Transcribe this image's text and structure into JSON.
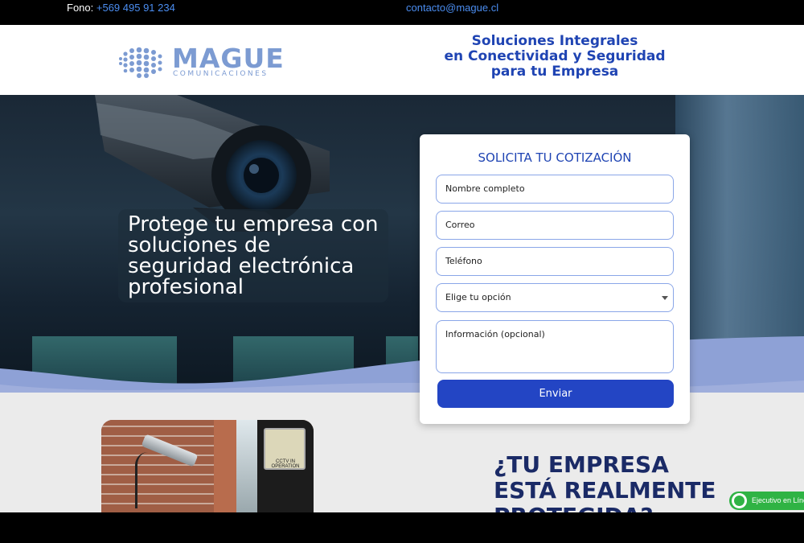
{
  "topbar": {
    "phone_label": "Fono:",
    "phone_number": "+569 495 91 234",
    "email": "contacto@mague.cl"
  },
  "header": {
    "logo_word": "MAGUE",
    "logo_sub": "COMUNICACIONES",
    "tagline_line1": "Soluciones Integrales",
    "tagline_line2": "en Conectividad y Seguridad",
    "tagline_line3": "para tu Empresa"
  },
  "hero": {
    "title": "Protege tu empresa con soluciones de seguridad electrónica profesional"
  },
  "form": {
    "title": "SOLICITA TU COTIZACIÓN",
    "name_placeholder": "Nombre completo",
    "email_placeholder": "Correo",
    "phone_placeholder": "Teléfono",
    "select_placeholder": "Elige tu opción",
    "info_placeholder": "Información (opcional)",
    "submit_label": "Enviar"
  },
  "lower": {
    "question": "¿TU EMPRESA ESTÁ REALMENTE PROTEGIDA?",
    "sign_text": "CCTV IN OPERATION"
  },
  "whatsapp": {
    "label": "Ejecutivo en Línea"
  },
  "colors": {
    "brand_blue": "#1f44b3",
    "button_blue": "#2345c4",
    "logo_blue": "#7c9bd2",
    "whatsapp_green": "#2fb344"
  }
}
